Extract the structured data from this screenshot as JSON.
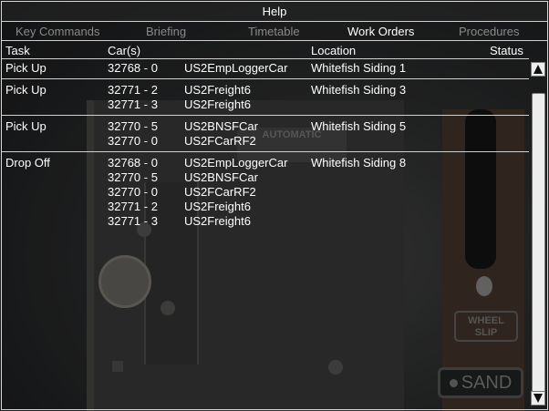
{
  "window": {
    "title": "Help"
  },
  "tabs": [
    {
      "label": "Key Commands",
      "active": false
    },
    {
      "label": "Briefing",
      "active": false
    },
    {
      "label": "Timetable",
      "active": false
    },
    {
      "label": "Work Orders",
      "active": true
    },
    {
      "label": "Procedures",
      "active": false
    }
  ],
  "columns": {
    "task": "Task",
    "cars": "Car(s)",
    "location": "Location",
    "status": "Status"
  },
  "orders": [
    {
      "task": "Pick Up",
      "location": "Whitefish Siding 1",
      "cars": [
        {
          "number": "32768 - 0",
          "name": "US2EmpLoggerCar"
        }
      ]
    },
    {
      "task": "Pick Up",
      "location": "Whitefish Siding 3",
      "cars": [
        {
          "number": "32771 - 2",
          "name": "US2Freight6"
        },
        {
          "number": "32771 - 3",
          "name": "US2Freight6"
        }
      ]
    },
    {
      "task": "Pick Up",
      "location": "Whitefish Siding 5",
      "cars": [
        {
          "number": "32770 - 5",
          "name": "US2BNSFCar"
        },
        {
          "number": "32770 - 0",
          "name": "US2FCarRF2"
        }
      ]
    },
    {
      "task": "Drop Off",
      "location": "Whitefish Siding 8",
      "cars": [
        {
          "number": "32768 - 0",
          "name": "US2EmpLoggerCar"
        },
        {
          "number": "32770 - 5",
          "name": "US2BNSFCar"
        },
        {
          "number": "32770 - 0",
          "name": "US2FCarRF2"
        },
        {
          "number": "32771 - 2",
          "name": "US2Freight6"
        },
        {
          "number": "32771 - 3",
          "name": "US2Freight6"
        }
      ]
    }
  ],
  "background": {
    "plate_text": "AUTOMATIC",
    "wheel_slip_label": "WHEEL SLIP",
    "sand_label": "SAND"
  },
  "colors": {
    "tab_active": "#ffffff",
    "tab_inactive": "#8a8a8a",
    "divider": "#d0d0d0"
  }
}
